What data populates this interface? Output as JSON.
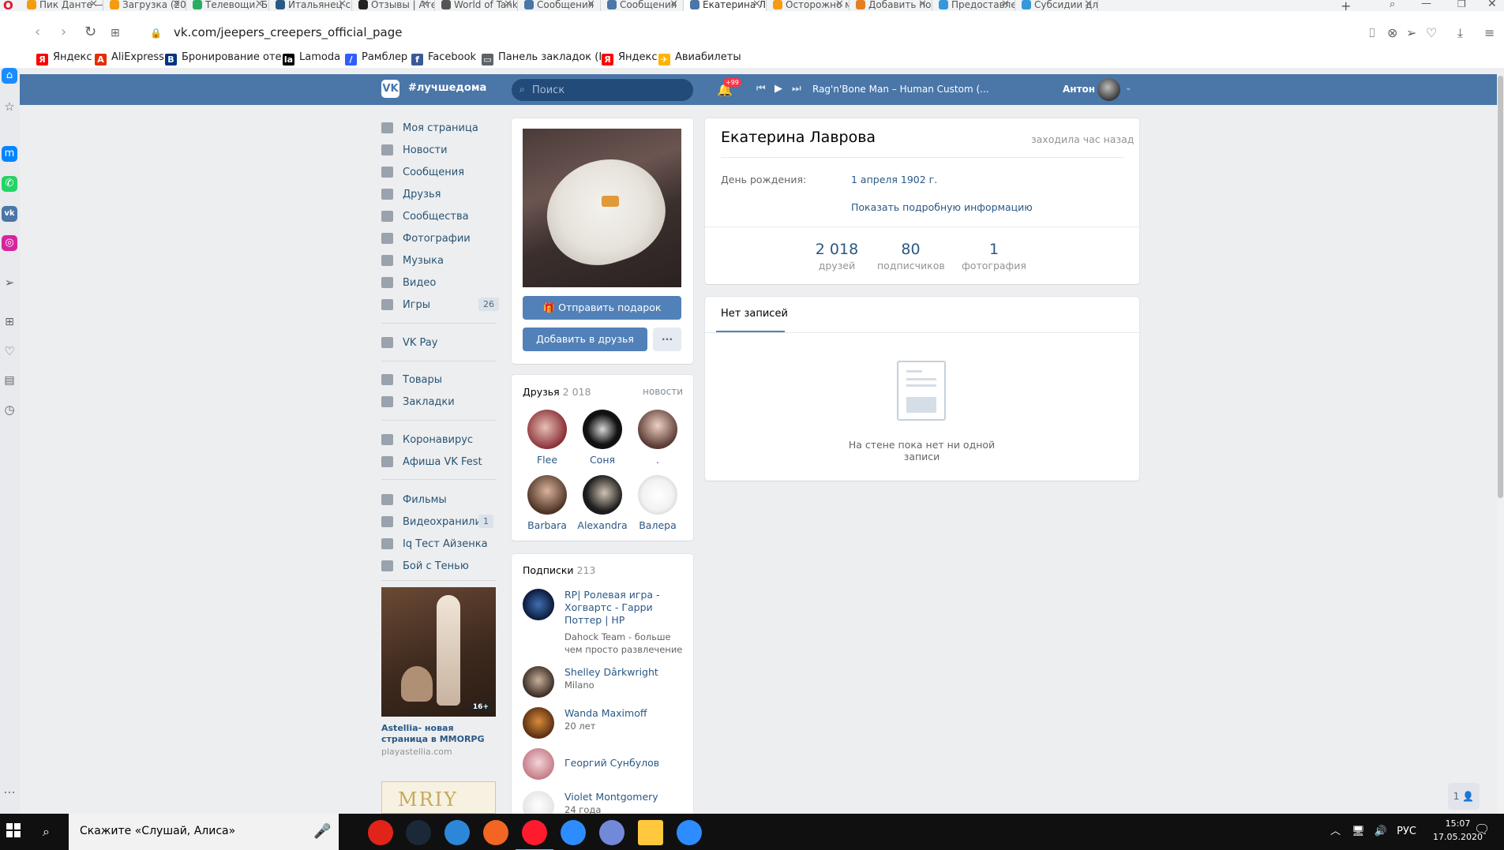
{
  "browser": {
    "tabs": [
      {
        "label": "Пик Данте —",
        "icon_color": "#f39c12",
        "active": false
      },
      {
        "label": "Загрузка (202",
        "icon_color": "#f39c12",
        "active": false
      },
      {
        "label": "Телевощи. Б",
        "icon_color": "#27ae60",
        "active": false
      },
      {
        "label": "Итальянец са",
        "icon_color": "#2a5885",
        "active": false
      },
      {
        "label": "Отзывы | Ате",
        "icon_color": "#222222",
        "active": false
      },
      {
        "label": "World of Tank",
        "icon_color": "#555555",
        "active": false
      },
      {
        "label": "Сообщения",
        "icon_color": "#4a76a8",
        "active": false
      },
      {
        "label": "Сообщения",
        "icon_color": "#4a76a8",
        "active": false
      },
      {
        "label": "Екатерина Ла",
        "icon_color": "#4a76a8",
        "active": true
      },
      {
        "label": "Осторожно м",
        "icon_color": "#f39c12",
        "active": false
      },
      {
        "label": "Добавить пос",
        "icon_color": "#e67e22",
        "active": false
      },
      {
        "label": "Предоставле",
        "icon_color": "#3498db",
        "active": false
      },
      {
        "label": "Субсидии дл",
        "icon_color": "#3498db",
        "active": false
      }
    ],
    "url": "vk.com/jeepers_creepers_official_page",
    "bookmarks": [
      {
        "label": "Яндекс",
        "icon": "Я",
        "color": "#ff0000"
      },
      {
        "label": "AliExpress",
        "icon": "A",
        "color": "#e62e04"
      },
      {
        "label": "Бронирование оте...",
        "icon": "B",
        "color": "#003580"
      },
      {
        "label": "Lamoda",
        "icon": "la",
        "color": "#000000"
      },
      {
        "label": "Рамблер",
        "icon": "/",
        "color": "#315efb"
      },
      {
        "label": "Facebook",
        "icon": "f",
        "color": "#3b5998"
      },
      {
        "label": "Панель закладок (I...",
        "icon": "▭",
        "color": "#5f6368"
      },
      {
        "label": "Яндекс",
        "icon": "Я",
        "color": "#ff0000"
      },
      {
        "label": "Авиабилеты",
        "icon": "✈",
        "color": "#ffb300"
      }
    ]
  },
  "vk_header": {
    "logo": "VK",
    "slogan": "#лучшедома",
    "search_placeholder": "Поиск",
    "notifications_badge": "+99",
    "now_playing": "Rag'n'Bone Man – Human Custom (...",
    "user_name": "Антон"
  },
  "left_menu": {
    "group1": [
      {
        "label": "Моя страница"
      },
      {
        "label": "Новости"
      },
      {
        "label": "Сообщения"
      },
      {
        "label": "Друзья"
      },
      {
        "label": "Сообщества"
      },
      {
        "label": "Фотографии"
      },
      {
        "label": "Музыка"
      },
      {
        "label": "Видео"
      },
      {
        "label": "Игры",
        "count": "26"
      }
    ],
    "group2": [
      {
        "label": "VK Pay"
      }
    ],
    "group3": [
      {
        "label": "Товары"
      },
      {
        "label": "Закладки"
      }
    ],
    "group4": [
      {
        "label": "Коронавирус"
      },
      {
        "label": "Афиша VK Fest"
      }
    ],
    "group5": [
      {
        "label": "Фильмы"
      },
      {
        "label": "Видеохранили...",
        "count": "1"
      },
      {
        "label": "Iq Тест Айзенка"
      },
      {
        "label": "Бой с Тенью"
      }
    ]
  },
  "ad": {
    "age_badge": "16+",
    "title": "Astellia- новая страница в MMORPG",
    "source": "playastellia.com",
    "second_ad_text": "MRIY"
  },
  "profile_actions": {
    "gift_button": "Отправить подарок",
    "add_friend_button": "Добавить в друзья",
    "more_button": "···"
  },
  "friends_block": {
    "title": "Друзья",
    "count": "2 018",
    "news_link": "новости",
    "friends": [
      {
        "name": "Flee"
      },
      {
        "name": "Соня"
      },
      {
        "name": "."
      },
      {
        "name": "Barbara"
      },
      {
        "name": "Alexandra"
      },
      {
        "name": "Валера"
      }
    ]
  },
  "subscriptions_block": {
    "title": "Подписки",
    "count": "213",
    "items": [
      {
        "name": "RP| Ролевая игра - Хогвартс - Гарри Поттер | HP",
        "desc": "Dahock Team - больше чем просто развлечение"
      },
      {
        "name": "Shelley Dârkwright",
        "desc": "Milano"
      },
      {
        "name": "Wanda Maximoff",
        "desc": "20 лет"
      },
      {
        "name": "Георгий Сунбулов",
        "desc": ""
      },
      {
        "name": "Violet Montgomery",
        "desc": "24 года"
      }
    ]
  },
  "profile": {
    "name": "Екатерина Лаврова",
    "last_seen": "заходила час назад",
    "birthday_label": "День рождения:",
    "birthday_value": "1 апреля 1902 г.",
    "more_info": "Показать подробную информацию",
    "counters": [
      {
        "number": "2 018",
        "caption": "друзей"
      },
      {
        "number": "80",
        "caption": "подписчиков"
      },
      {
        "number": "1",
        "caption": "фотография"
      }
    ]
  },
  "wall": {
    "tab": "Нет записей",
    "empty_text": "На стене пока нет ни одной записи"
  },
  "chat_corner": "1 👤",
  "taskbar": {
    "search_text": "Скажите «Слушай, Алиса»",
    "tray_lang": "РУС",
    "time": "15:07",
    "date": "17.05.2020"
  }
}
